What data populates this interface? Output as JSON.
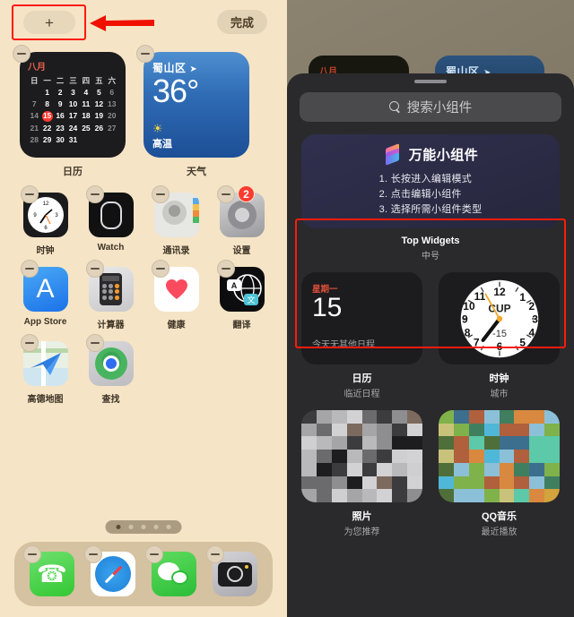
{
  "left_phone": {
    "top_bar": {
      "add_label": "+",
      "done_label": "完成"
    },
    "widgets": [
      {
        "name": "calendar",
        "label": "日历",
        "month": "八月",
        "weekday_headers": [
          "日",
          "一",
          "二",
          "三",
          "四",
          "五",
          "六"
        ],
        "weeks": [
          [
            "",
            "1",
            "2",
            "3",
            "4",
            "5",
            "6"
          ],
          [
            "7",
            "8",
            "9",
            "10",
            "11",
            "12",
            "13"
          ],
          [
            "14",
            "15",
            "16",
            "17",
            "18",
            "19",
            "20"
          ],
          [
            "21",
            "22",
            "23",
            "24",
            "25",
            "26",
            "27"
          ],
          [
            "28",
            "29",
            "30",
            "31",
            "",
            "",
            ""
          ]
        ],
        "today": "15",
        "dim_days": [
          "6",
          "7",
          "13",
          "14",
          "20",
          "21",
          "27",
          "28"
        ]
      },
      {
        "name": "weather",
        "label": "天气",
        "city": "蜀山区",
        "temperature": "36°",
        "condition": "高温",
        "condition_icon": "sun-icon"
      }
    ],
    "apps": [
      {
        "name": "时钟",
        "icon": "clock-icon",
        "badge": ""
      },
      {
        "name": "Watch",
        "icon": "watch-icon",
        "badge": ""
      },
      {
        "name": "通讯录",
        "icon": "contacts-icon",
        "badge": ""
      },
      {
        "name": "设置",
        "icon": "settings-icon",
        "badge": "2"
      },
      {
        "name": "App Store",
        "icon": "appstore-icon",
        "badge": ""
      },
      {
        "name": "计算器",
        "icon": "calculator-icon",
        "badge": ""
      },
      {
        "name": "健康",
        "icon": "health-icon",
        "badge": ""
      },
      {
        "name": "翻译",
        "icon": "translate-icon",
        "badge": ""
      },
      {
        "name": "高德地图",
        "icon": "maps-icon",
        "badge": ""
      },
      {
        "name": "查找",
        "icon": "find-my-icon",
        "badge": ""
      }
    ],
    "page_dots": {
      "count": 5,
      "active_index": 0
    },
    "dock": [
      {
        "name": "电话",
        "icon": "phone-icon"
      },
      {
        "name": "Safari",
        "icon": "safari-icon"
      },
      {
        "name": "微信",
        "icon": "wechat-icon"
      },
      {
        "name": "相机",
        "icon": "camera-icon"
      }
    ]
  },
  "right_phone": {
    "peek": {
      "calendar_month": "八月",
      "weather_city": "蜀山区"
    },
    "search": {
      "placeholder": "搜索小组件",
      "icon": "search-icon"
    },
    "featured": {
      "title": "万能小组件",
      "logo_icon": "stacked-cards-icon",
      "steps": [
        "1. 长按进入编辑模式",
        "2. 点击编辑小组件",
        "3. 选择所需小组件类型"
      ],
      "caption": "Top Widgets",
      "size_label": "中号"
    },
    "widget_list": [
      {
        "name": "日历",
        "subtitle": "临近日程",
        "preview": {
          "type": "calendar",
          "weekday": "星期一",
          "day": "15",
          "note": "今天无其他日程"
        }
      },
      {
        "name": "时钟",
        "subtitle": "城市",
        "preview": {
          "type": "clock",
          "city_code": "CUP",
          "offset": "-15"
        }
      },
      {
        "name": "照片",
        "subtitle": "为您推荐",
        "preview": {
          "type": "photo-mosaic-gray"
        }
      },
      {
        "name": "QQ音乐",
        "subtitle": "最近播放",
        "preview": {
          "type": "photo-mosaic-color"
        }
      }
    ]
  },
  "annotations": {
    "arrow_icon": "left-arrow-icon",
    "highlight_color": "#fc1b0b",
    "boxes": [
      "add-button-highlight",
      "featured-widget-highlight"
    ]
  }
}
